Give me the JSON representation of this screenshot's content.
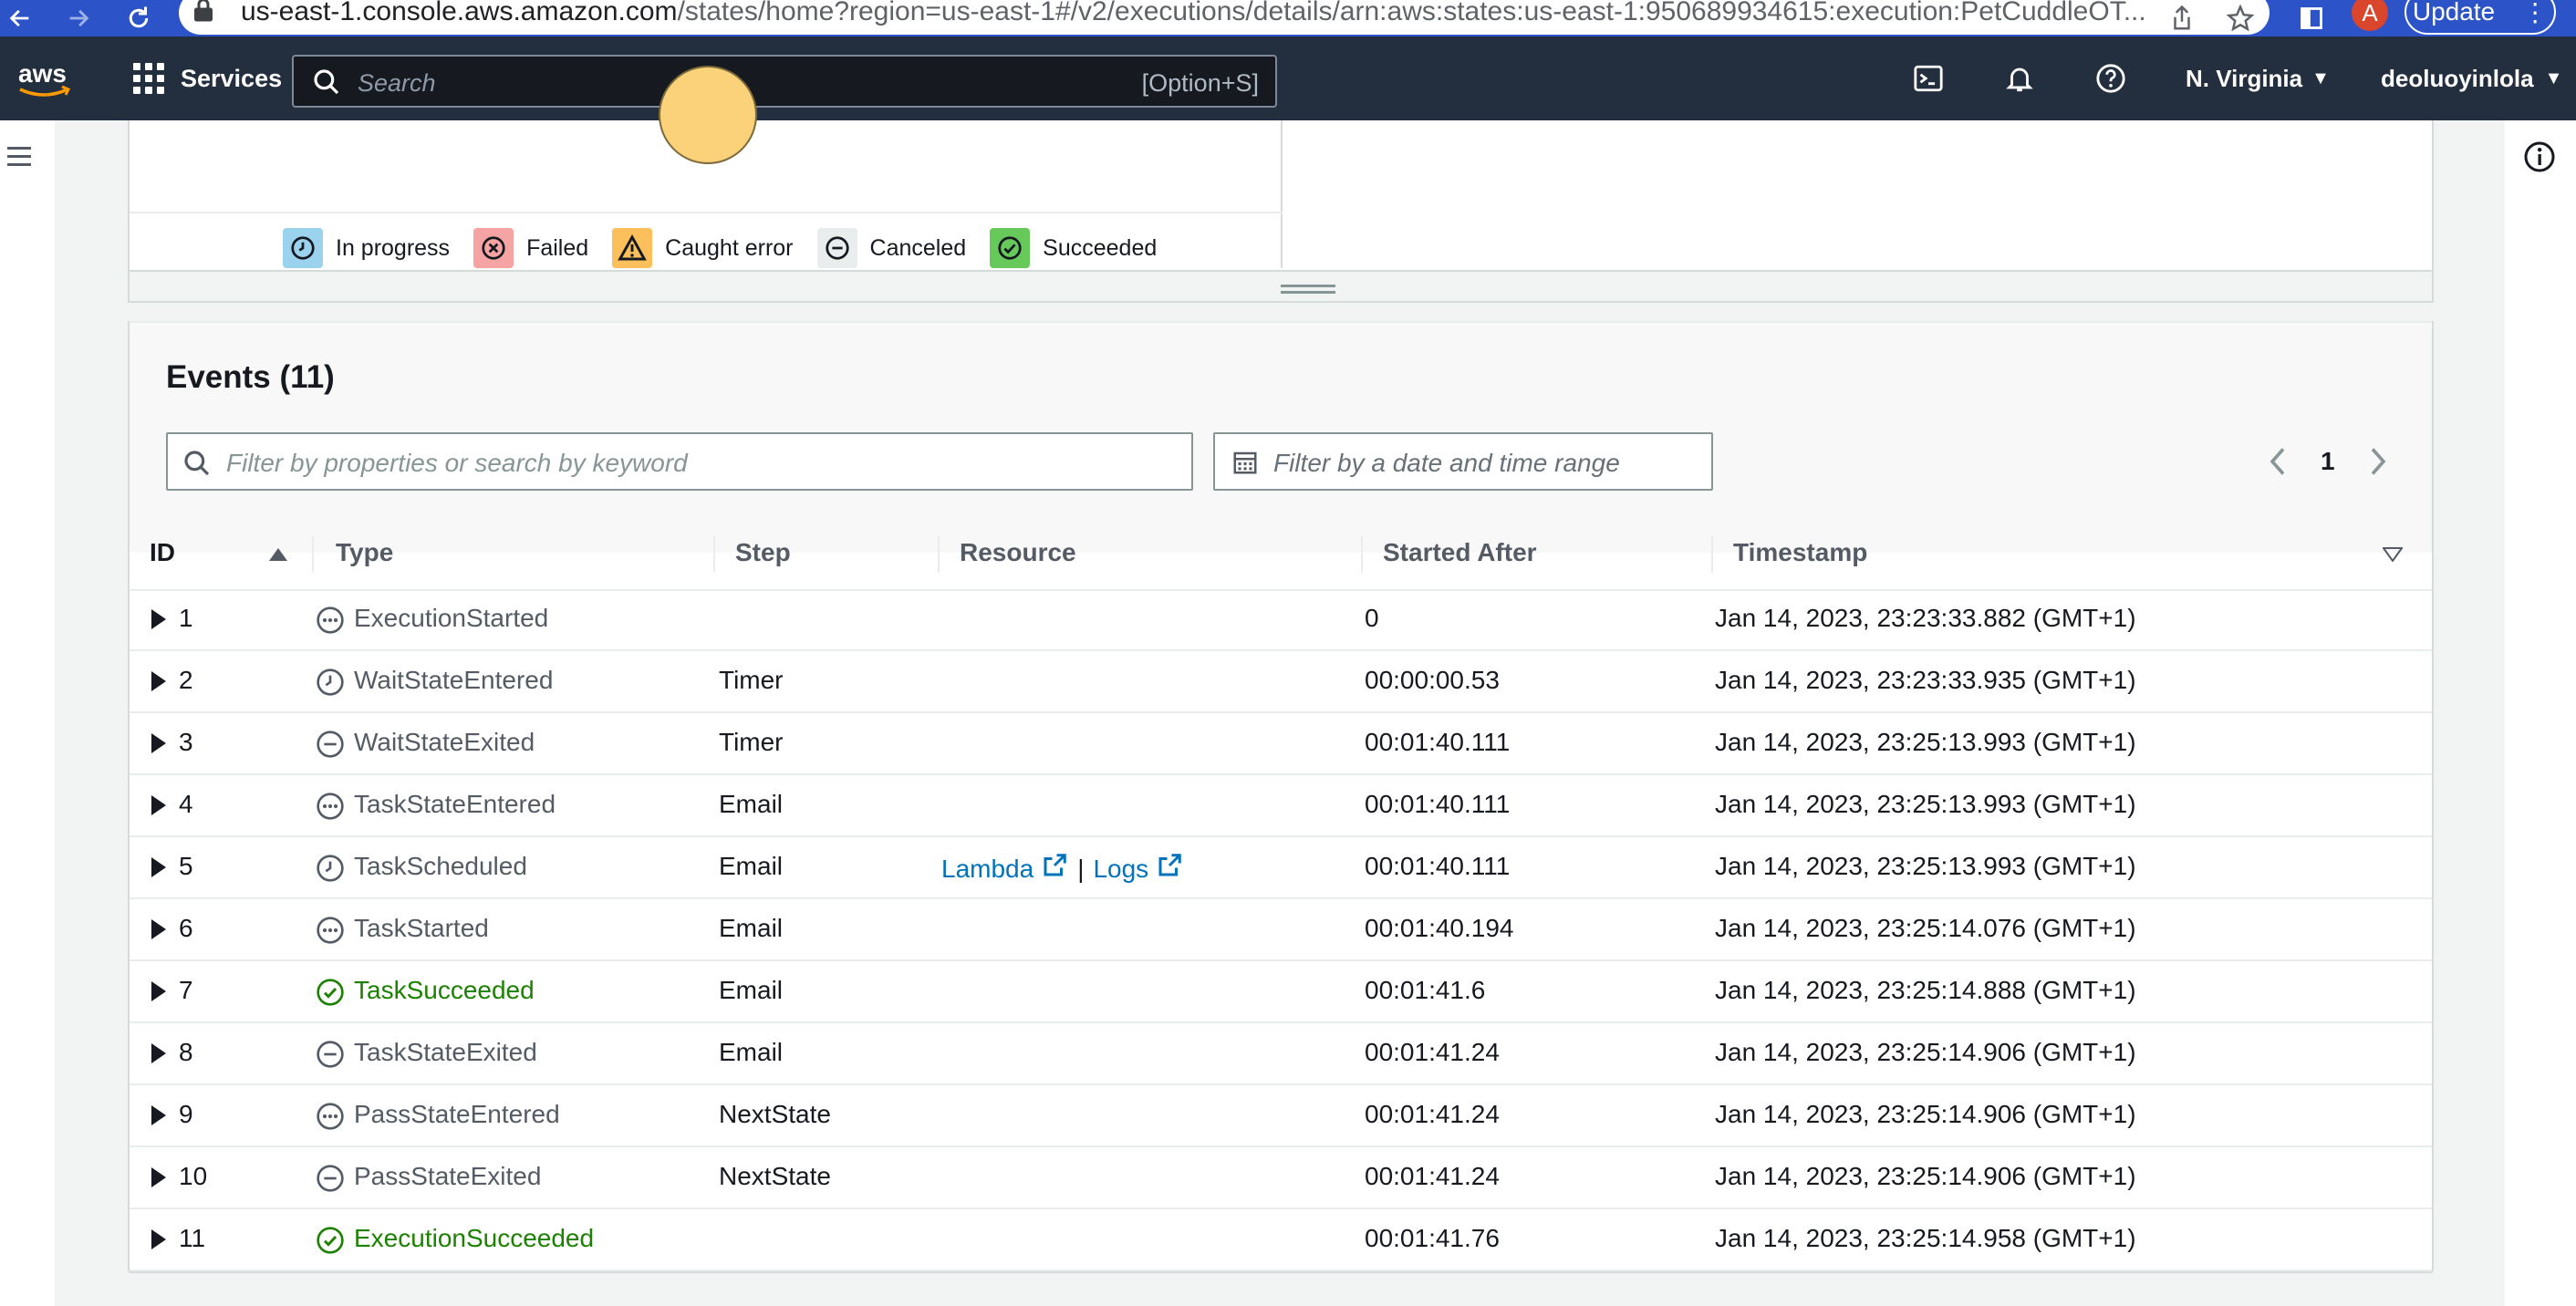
{
  "browser": {
    "url_host": "us-east-1.console.aws.amazon.com",
    "url_path": "/states/home?region=us-east-1#/v2/executions/details/arn:aws:states:us-east-1:950689934615:execution:PetCuddleOT...",
    "avatar_letter": "A",
    "update_label": "Update"
  },
  "topnav": {
    "services_label": "Services",
    "search_placeholder": "Search",
    "search_shortcut": "[Option+S]",
    "region": "N. Virginia",
    "account": "deoluoyinlola"
  },
  "legend": [
    {
      "label": "In progress",
      "color": "#9bd3ef",
      "icon": "clock-icon"
    },
    {
      "label": "Failed",
      "color": "#f5a3a3",
      "icon": "x-circle-icon"
    },
    {
      "label": "Caught error",
      "color": "#fbbf5c",
      "icon": "warning-icon"
    },
    {
      "label": "Canceled",
      "color": "#eaeded",
      "icon": "minus-circle-icon"
    },
    {
      "label": "Succeeded",
      "color": "#67c95a",
      "icon": "check-circle-icon"
    }
  ],
  "events": {
    "title": "Events (11)",
    "filter_placeholder": "Filter by properties or search by keyword",
    "date_placeholder": "Filter by a date and time range",
    "page": "1",
    "columns": [
      "ID",
      "Type",
      "Step",
      "Resource",
      "Started After",
      "Timestamp"
    ],
    "rows": [
      {
        "id": "1",
        "type": "ExecutionStarted",
        "icon": "dots",
        "status": "neutral",
        "step": "",
        "resource": false,
        "started": "0",
        "timestamp": "Jan 14, 2023, 23:23:33.882 (GMT+1)"
      },
      {
        "id": "2",
        "type": "WaitStateEntered",
        "icon": "clock",
        "status": "neutral",
        "step": "Timer",
        "resource": false,
        "started": "00:00:00.53",
        "timestamp": "Jan 14, 2023, 23:23:33.935 (GMT+1)"
      },
      {
        "id": "3",
        "type": "WaitStateExited",
        "icon": "minus",
        "status": "neutral",
        "step": "Timer",
        "resource": false,
        "started": "00:01:40.111",
        "timestamp": "Jan 14, 2023, 23:25:13.993 (GMT+1)"
      },
      {
        "id": "4",
        "type": "TaskStateEntered",
        "icon": "dots",
        "status": "neutral",
        "step": "Email",
        "resource": false,
        "started": "00:01:40.111",
        "timestamp": "Jan 14, 2023, 23:25:13.993 (GMT+1)"
      },
      {
        "id": "5",
        "type": "TaskScheduled",
        "icon": "clock",
        "status": "neutral",
        "step": "Email",
        "resource": true,
        "started": "00:01:40.111",
        "timestamp": "Jan 14, 2023, 23:25:13.993 (GMT+1)"
      },
      {
        "id": "6",
        "type": "TaskStarted",
        "icon": "dots",
        "status": "neutral",
        "step": "Email",
        "resource": false,
        "started": "00:01:40.194",
        "timestamp": "Jan 14, 2023, 23:25:14.076 (GMT+1)"
      },
      {
        "id": "7",
        "type": "TaskSucceeded",
        "icon": "check",
        "status": "success",
        "step": "Email",
        "resource": false,
        "started": "00:01:41.6",
        "timestamp": "Jan 14, 2023, 23:25:14.888 (GMT+1)"
      },
      {
        "id": "8",
        "type": "TaskStateExited",
        "icon": "minus",
        "status": "neutral",
        "step": "Email",
        "resource": false,
        "started": "00:01:41.24",
        "timestamp": "Jan 14, 2023, 23:25:14.906 (GMT+1)"
      },
      {
        "id": "9",
        "type": "PassStateEntered",
        "icon": "dots",
        "status": "neutral",
        "step": "NextState",
        "resource": false,
        "started": "00:01:41.24",
        "timestamp": "Jan 14, 2023, 23:25:14.906 (GMT+1)"
      },
      {
        "id": "10",
        "type": "PassStateExited",
        "icon": "minus",
        "status": "neutral",
        "step": "NextState",
        "resource": false,
        "started": "00:01:41.24",
        "timestamp": "Jan 14, 2023, 23:25:14.906 (GMT+1)"
      },
      {
        "id": "11",
        "type": "ExecutionSucceeded",
        "icon": "check",
        "status": "success",
        "step": "",
        "resource": false,
        "started": "00:01:41.76",
        "timestamp": "Jan 14, 2023, 23:25:14.958 (GMT+1)"
      }
    ],
    "resource_links": {
      "lambda": "Lambda",
      "separator": "|",
      "logs": "Logs"
    }
  },
  "colors": {
    "success": "#1d8102",
    "link": "#0073bb",
    "aws_nav": "#232f3e",
    "browser_bar": "#2c54c8"
  }
}
